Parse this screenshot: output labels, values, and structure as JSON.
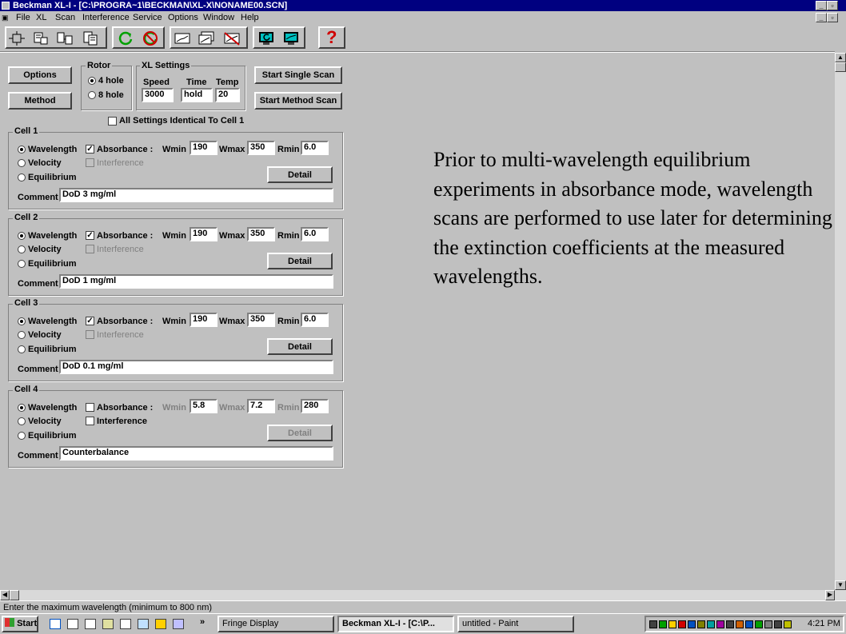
{
  "window": {
    "title": "Beckman XL-I - [C:\\PROGRA~1\\BECKMAN\\XL-X\\NONAME00.SCN]"
  },
  "menu": [
    "File",
    "XL",
    "Scan",
    "Interference",
    "Service",
    "Options",
    "Window",
    "Help"
  ],
  "toolbar": {
    "help_label": "?"
  },
  "controls": {
    "options_label": "Options",
    "method_label": "Method"
  },
  "rotor": {
    "title": "Rotor",
    "opt1": "4 hole",
    "opt2": "8 hole",
    "selected": "4 hole"
  },
  "xl_settings": {
    "title": "XL Settings",
    "speed_label": "Speed",
    "time_label": "Time",
    "temp_label": "Temp",
    "speed": "3000",
    "time": "hold",
    "temp": "20"
  },
  "scan_buttons": {
    "single": "Start Single Scan",
    "method": "Start Method Scan"
  },
  "identical_label": "All Settings Identical To Cell 1",
  "labels": {
    "wavelength": "Wavelength",
    "velocity": "Velocity",
    "equilibrium": "Equilibrium",
    "absorbance": "Absorbance :",
    "interference": "Interference",
    "wmin": "Wmin",
    "wmax": "Wmax",
    "rmin": "Rmin",
    "detail": "Detail",
    "comment": "Comment"
  },
  "cells": [
    {
      "title": "Cell 1",
      "absorbance_checked": true,
      "wmin": "190",
      "wmax": "350",
      "rmin": "6.0",
      "comment": "DoD 3 mg/ml"
    },
    {
      "title": "Cell 2",
      "absorbance_checked": true,
      "wmin": "190",
      "wmax": "350",
      "rmin": "6.0",
      "comment": "DoD 1 mg/ml"
    },
    {
      "title": "Cell 3",
      "absorbance_checked": true,
      "wmin": "190",
      "wmax": "350",
      "rmin": "6.0",
      "comment": "DoD 0.1 mg/ml"
    },
    {
      "title": "Cell 4",
      "absorbance_checked": false,
      "wmin": "5.8",
      "wmax": "7.2",
      "rmin": "280",
      "comment": "Counterbalance"
    }
  ],
  "caption": "Prior to multi-wavelength equilibrium experiments in absorbance mode, wavelength scans are performed to use later for determining the extinction coefficients at the measured wavelengths.",
  "status": "Enter the maximum wavelength (minimum to 800 nm)",
  "taskbar": {
    "start": "Start",
    "tasks": [
      "Fringe Display",
      "Beckman XL-I - [C:\\P...",
      "untitled - Paint"
    ],
    "clock": "4:21 PM",
    "more": "»"
  },
  "colors": {
    "titlebar": "#000080",
    "face": "#c0c0c0",
    "refresh_icon": "#00a000",
    "stop_icon": "#d00000",
    "help_icon": "#d00000"
  }
}
